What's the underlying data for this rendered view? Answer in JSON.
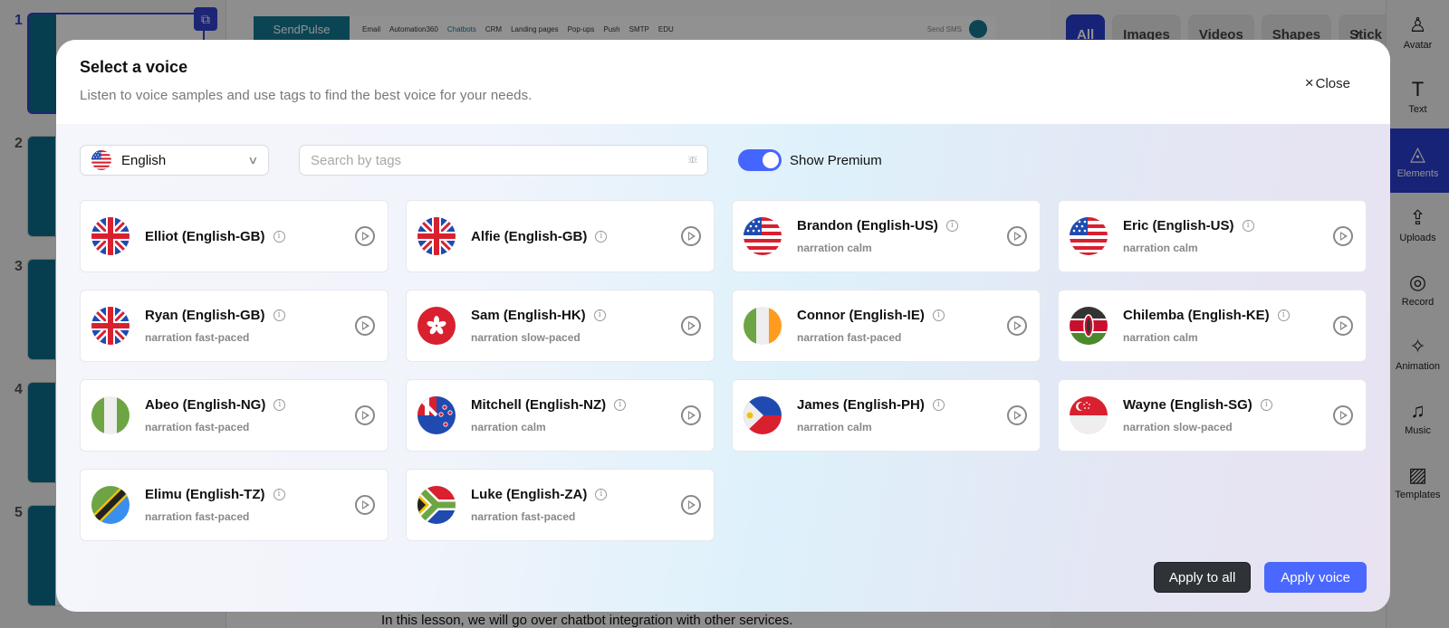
{
  "background": {
    "slides": [
      {
        "number": "1",
        "active": true
      },
      {
        "number": "2",
        "active": false
      },
      {
        "number": "3",
        "active": false
      },
      {
        "number": "4",
        "active": false
      },
      {
        "number": "5",
        "active": false
      }
    ],
    "topbar": {
      "logo": "SendPulse",
      "nav": [
        "Email",
        "Automation360",
        "Chatbots",
        "CRM",
        "Landing pages",
        "Pop-ups",
        "Push",
        "SMTP",
        "EDU"
      ],
      "active_nav": "Chatbots",
      "send_sms": "Send SMS"
    },
    "caption": "In this lesson, we will go over chatbot integration with other services.",
    "panel_tabs": [
      "All",
      "Images",
      "Videos",
      "Shapes",
      "Stick"
    ],
    "active_panel_tab": "All"
  },
  "rail": {
    "items": [
      {
        "label": "Avatar",
        "icon": "avatar-icon",
        "glyph": "♙",
        "active": false
      },
      {
        "label": "Text",
        "icon": "text-icon",
        "glyph": "T",
        "active": false
      },
      {
        "label": "Elements",
        "icon": "shapes-icon",
        "glyph": "◬",
        "active": true
      },
      {
        "label": "Uploads",
        "icon": "upload-icon",
        "glyph": "⇪",
        "active": false
      },
      {
        "label": "Record",
        "icon": "record-icon",
        "glyph": "◎",
        "active": false
      },
      {
        "label": "Animation",
        "icon": "sparkle-icon",
        "glyph": "✧",
        "active": false
      },
      {
        "label": "Music",
        "icon": "music-icon",
        "glyph": "♫",
        "active": false
      },
      {
        "label": "Templates",
        "icon": "image-icon",
        "glyph": "▨",
        "active": false
      }
    ]
  },
  "modal": {
    "title": "Select a voice",
    "subtitle": "Listen to voice samples and use tags to find the best voice for your needs.",
    "close_label": "Close",
    "language": {
      "selected": "English",
      "flag": "US"
    },
    "search": {
      "placeholder": "Search by tags",
      "value": ""
    },
    "premium_toggle": {
      "label": "Show Premium",
      "on": true
    },
    "voices": [
      {
        "name": "Elliot (English-GB)",
        "tags": "",
        "flag": "GB"
      },
      {
        "name": "Alfie (English-GB)",
        "tags": "",
        "flag": "GB"
      },
      {
        "name": "Brandon (English-US)",
        "tags": "narration calm",
        "flag": "US"
      },
      {
        "name": "Eric (English-US)",
        "tags": "narration calm",
        "flag": "US"
      },
      {
        "name": "Ryan (English-GB)",
        "tags": "narration fast-paced",
        "flag": "GB"
      },
      {
        "name": "Sam (English-HK)",
        "tags": "narration slow-paced",
        "flag": "HK"
      },
      {
        "name": "Connor (English-IE)",
        "tags": "narration fast-paced",
        "flag": "IE"
      },
      {
        "name": "Chilemba (English-KE)",
        "tags": "narration calm",
        "flag": "KE"
      },
      {
        "name": "Abeo (English-NG)",
        "tags": "narration fast-paced",
        "flag": "NG"
      },
      {
        "name": "Mitchell (English-NZ)",
        "tags": "narration calm",
        "flag": "NZ"
      },
      {
        "name": "James (English-PH)",
        "tags": "narration calm",
        "flag": "PH"
      },
      {
        "name": "Wayne (English-SG)",
        "tags": "narration slow-paced",
        "flag": "SG"
      },
      {
        "name": "Elimu (English-TZ)",
        "tags": "narration fast-paced",
        "flag": "TZ"
      },
      {
        "name": "Luke (English-ZA)",
        "tags": "narration fast-paced",
        "flag": "ZA"
      }
    ],
    "buttons": {
      "apply_all": "Apply to all",
      "apply_voice": "Apply voice"
    },
    "colors": {
      "accent": "#4a68ff",
      "dark_button": "#2f3338"
    }
  }
}
